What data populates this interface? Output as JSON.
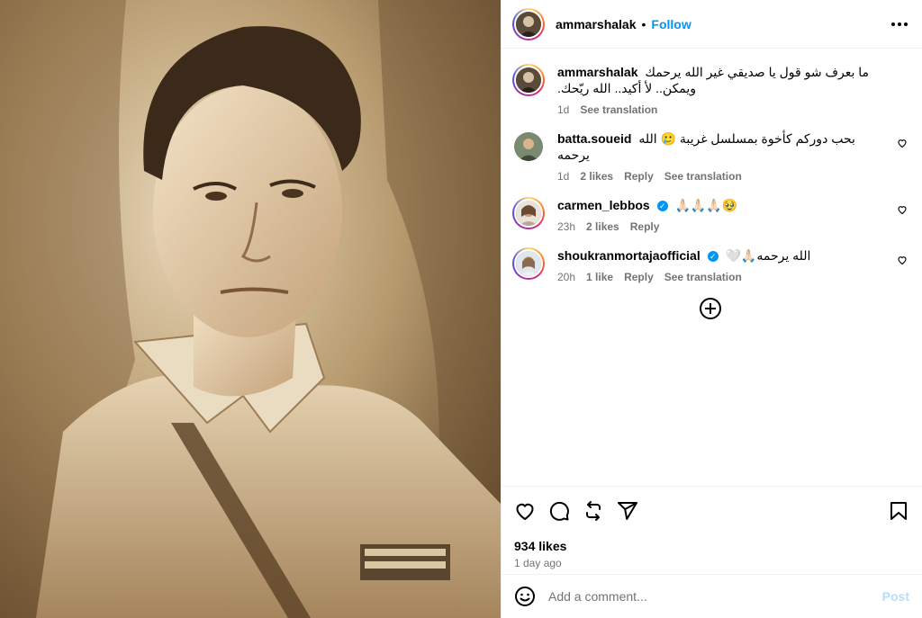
{
  "post": {
    "image_icon": "sepia-portrait-photo"
  },
  "header": {
    "username": "ammarshalak",
    "separator": "•",
    "follow_label": "Follow"
  },
  "caption": {
    "username": "ammarshalak",
    "line1": "ما بعرف شو قول يا صديقي غير الله يرحمك",
    "line2": "ويمكن.. لأ أكيد.. الله ريّحك.",
    "time": "1d",
    "see_translation": "See translation"
  },
  "comments": [
    {
      "username": "batta.soueid",
      "verified": false,
      "text": "بحب دوركم كأخوة بمسلسل غريبة 🥲 الله يرحمه",
      "time": "1d",
      "likes": "2 likes",
      "reply": "Reply",
      "see_translation": "See translation"
    },
    {
      "username": "carmen_lebbos",
      "verified": true,
      "text": "🙏🏻🙏🏻🙏🏻🥹",
      "time": "23h",
      "likes": "2 likes",
      "reply": "Reply"
    },
    {
      "username": "shoukranmortajaofficial",
      "verified": true,
      "text": "🤍🙏🏻الله يرحمه",
      "time": "20h",
      "likes": "1 like",
      "reply": "Reply",
      "see_translation": "See translation"
    }
  ],
  "footer": {
    "likes_count": "934 likes",
    "time_ago": "1 day ago",
    "comment_placeholder": "Add a comment...",
    "post_label": "Post"
  },
  "colors": {
    "accent": "#0095f6",
    "post_disabled": "#b2dffc",
    "muted": "#737373"
  }
}
